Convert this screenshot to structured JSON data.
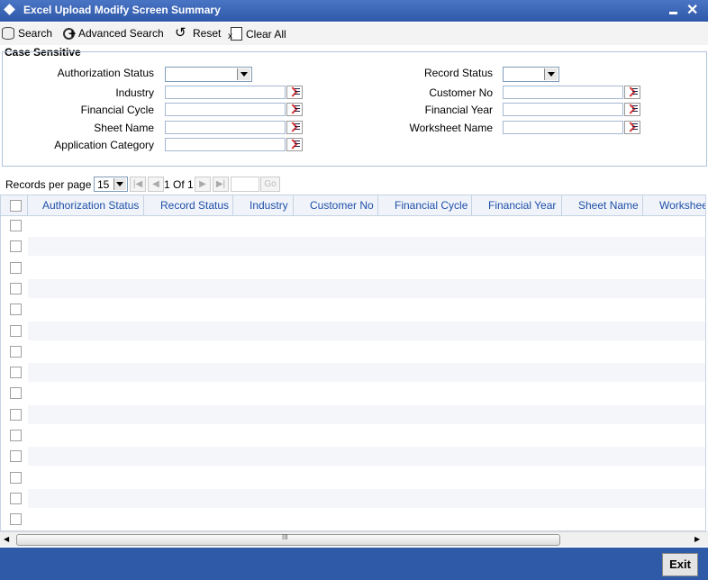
{
  "window": {
    "title": "Excel Upload Modify Screen Summary"
  },
  "toolbar": {
    "search": "Search",
    "advanced_search": "Advanced Search",
    "reset": "Reset",
    "clear_all": "Clear All"
  },
  "criteria": {
    "section_label": "Case Sensitive",
    "authorization_status": {
      "label": "Authorization Status",
      "value": ""
    },
    "record_status": {
      "label": "Record Status",
      "value": ""
    },
    "industry": {
      "label": "Industry",
      "value": ""
    },
    "customer_no": {
      "label": "Customer No",
      "value": ""
    },
    "financial_cycle": {
      "label": "Financial Cycle",
      "value": ""
    },
    "financial_year": {
      "label": "Financial Year",
      "value": ""
    },
    "sheet_name": {
      "label": "Sheet Name",
      "value": ""
    },
    "worksheet_name": {
      "label": "Worksheet Name",
      "value": ""
    },
    "application_category": {
      "label": "Application Category",
      "value": ""
    }
  },
  "pager": {
    "records_per_page_label": "Records per page",
    "records_per_page": "15",
    "page_text": "1 Of 1",
    "go_label": "Go"
  },
  "grid": {
    "columns": [
      "Authorization Status",
      "Record Status",
      "Industry",
      "Customer No",
      "Financial Cycle",
      "Financial Year",
      "Sheet Name",
      "Worksheet"
    ],
    "row_count": 15
  },
  "footer": {
    "exit": "Exit"
  },
  "colors": {
    "title_bar": "#2e58a8",
    "footer": "#2f5aa8",
    "header_text": "#1f4fa8"
  },
  "icons": {
    "search": "database-icon",
    "advanced": "add-search-icon",
    "reset": "reset-icon",
    "clear": "clear-icon",
    "lov": "list-of-values-icon"
  }
}
